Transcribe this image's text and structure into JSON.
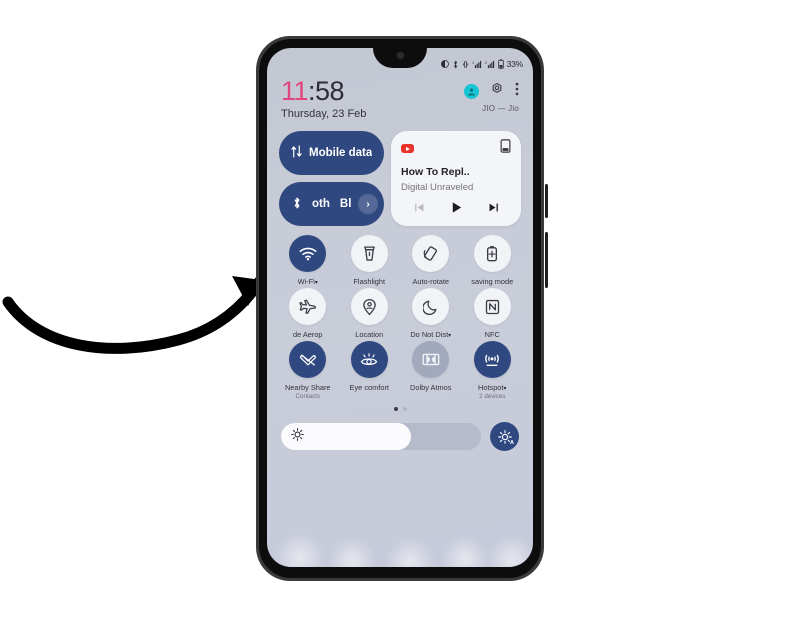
{
  "annotation": {
    "arrow_name": "curved-pointer-arrow",
    "color": "#000000"
  },
  "phone": {
    "status_bar": {
      "icons": [
        "dnd-icon",
        "bluetooth-icon",
        "vibrate-icon",
        "signal-sim1-icon",
        "signal-sim2-icon",
        "battery-icon"
      ],
      "battery_percent": "33%"
    },
    "header": {
      "time_hours": "11",
      "time_minutes": ":58",
      "date": "Thursday, 23 Feb",
      "carrier": "JIO — Jio",
      "avatar_icon": "user-avatar-icon",
      "settings_icon": "gear-icon",
      "more_icon": "three-dots-icon"
    },
    "big_toggles": [
      {
        "name": "mobile-data-toggle",
        "label": "Mobile data",
        "icon": "data-arrows-icon",
        "state": "on"
      },
      {
        "name": "bluetooth-toggle",
        "label_a": "oth",
        "label_b": "Bl",
        "icon": "bluetooth-icon",
        "state": "on",
        "chevron": "›"
      }
    ],
    "media_card": {
      "app_icon": "youtube-icon",
      "cast_icon": "cast-device-icon",
      "title": "How To Repl..",
      "subtitle": "Digital Unraveled",
      "controls": {
        "previous": "previous-track-icon",
        "play": "play-icon",
        "next": "next-track-icon"
      }
    },
    "quick_settings": [
      {
        "name": "wifi-tile",
        "icon": "wifi-icon",
        "label": "Wi-Fi",
        "caret": "▾",
        "sub": "",
        "state": "on"
      },
      {
        "name": "flashlight-tile",
        "icon": "flashlight-icon",
        "label": "Flashlight",
        "caret": "",
        "sub": "",
        "state": "off"
      },
      {
        "name": "auto-rotate-tile",
        "icon": "auto-rotate-icon",
        "label": "Auto-rotate",
        "caret": "",
        "sub": "",
        "state": "off"
      },
      {
        "name": "power-saving-tile",
        "icon": "battery-saver-icon",
        "label": "saving mode",
        "caret": "",
        "sub": "",
        "state": "off"
      },
      {
        "name": "aeroplane-tile",
        "icon": "aeroplane-icon",
        "label": "de   Aerop",
        "caret": "",
        "sub": "",
        "state": "off"
      },
      {
        "name": "location-tile",
        "icon": "location-pin-icon",
        "label": "Location",
        "caret": "",
        "sub": "",
        "state": "off"
      },
      {
        "name": "dnd-tile",
        "icon": "moon-icon",
        "label": "Do Not Dist",
        "caret": "▾",
        "sub": "",
        "state": "off"
      },
      {
        "name": "nfc-tile",
        "icon": "nfc-icon",
        "label": "NFC",
        "caret": "",
        "sub": "",
        "state": "off"
      },
      {
        "name": "nearby-share-tile",
        "icon": "nearby-share-icon",
        "label": "Nearby Share",
        "caret": "",
        "sub": "Contacts",
        "state": "on"
      },
      {
        "name": "eye-comfort-tile",
        "icon": "eye-comfort-icon",
        "label": "Eye comfort",
        "caret": "",
        "sub": "",
        "state": "on"
      },
      {
        "name": "dolby-atmos-tile",
        "icon": "dolby-atmos-icon",
        "label": "Dolby Atmos",
        "caret": "",
        "sub": "",
        "state": "neutral"
      },
      {
        "name": "hotspot-tile",
        "icon": "hotspot-icon",
        "label": "Hotspot",
        "caret": "▾",
        "sub": "2 devices",
        "state": "on"
      }
    ],
    "page_dots": {
      "count": 2,
      "active_index": 0
    },
    "brightness": {
      "slider_icon": "brightness-sun-icon",
      "value_percent": 65,
      "auto_button_icon": "auto-brightness-icon",
      "auto_button_badge": "A"
    }
  },
  "colors": {
    "accent_blue": "#2f4880",
    "clock_pink": "#e0457b",
    "screen_bg": "#c6cad8",
    "tile_off": "#f2f3f7",
    "tile_neutral": "#a3a9bd"
  }
}
